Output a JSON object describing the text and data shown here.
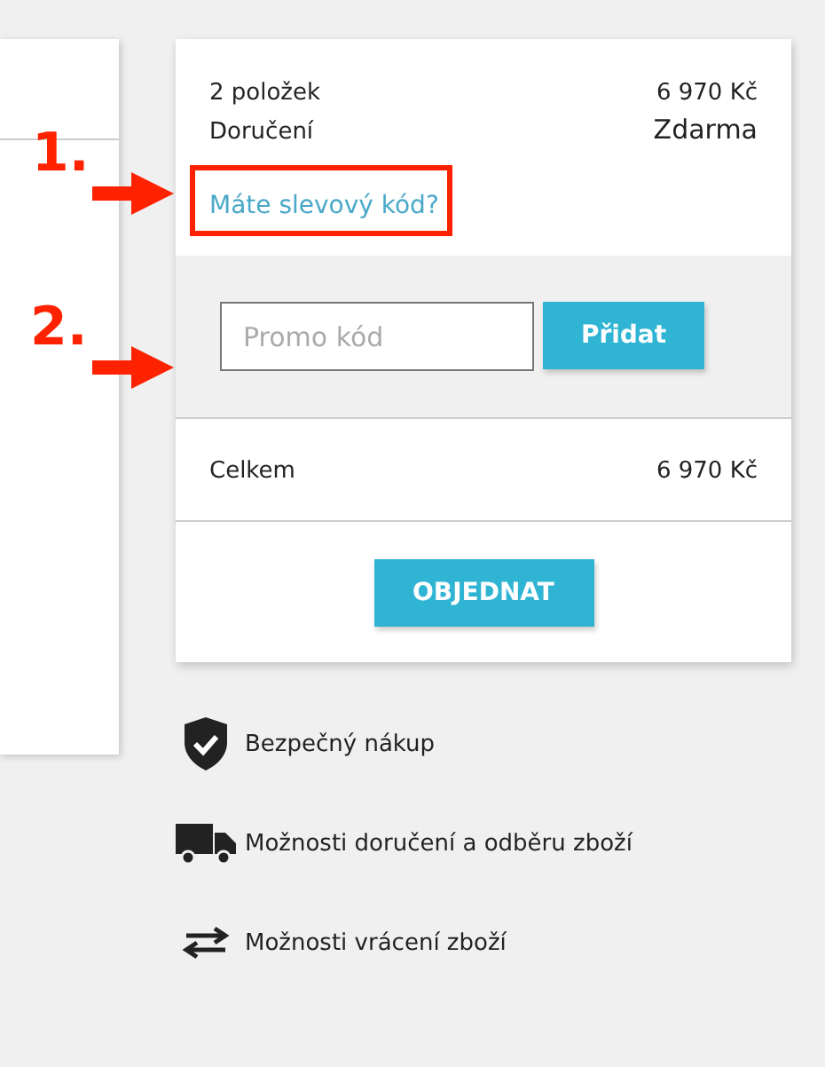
{
  "summary": {
    "rows": [
      {
        "label": "2 položek",
        "value": "6 970 Kč"
      },
      {
        "label": "Doručení",
        "value": "Zdarma"
      }
    ],
    "discount_link": "Máte slevový kód?"
  },
  "promo": {
    "placeholder": "Promo kód",
    "button": "Přidat"
  },
  "total": {
    "label": "Celkem",
    "value": "6 970 Kč"
  },
  "order_button": "OBJEDNAT",
  "features": [
    {
      "kind": "shield",
      "label": "Bezpečný nákup"
    },
    {
      "kind": "truck",
      "label": "Možnosti doručení a odběru zboží"
    },
    {
      "kind": "arrows",
      "label": "Možnosti vrácení zboží"
    }
  ],
  "annotations": [
    {
      "label": "1."
    },
    {
      "label": "2."
    }
  ]
}
